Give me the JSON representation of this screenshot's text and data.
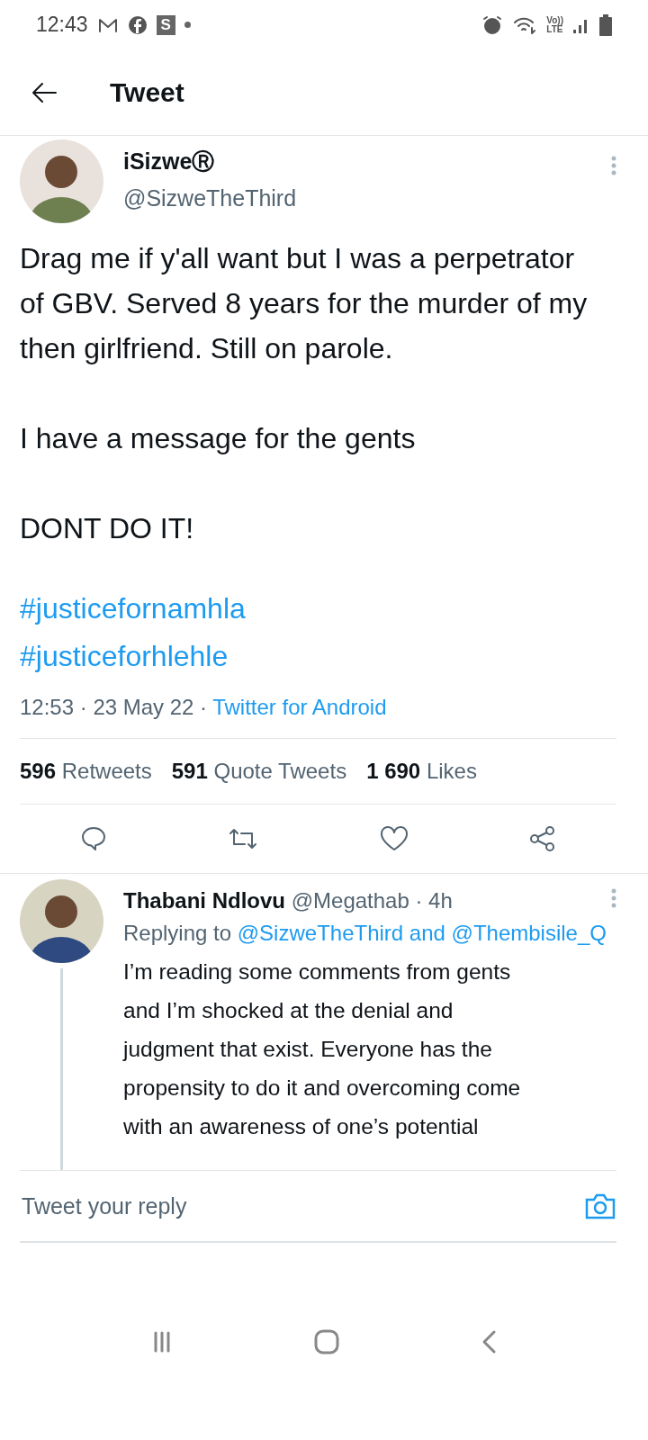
{
  "status_bar": {
    "time": "12:43",
    "app_badge": "S",
    "network_top": "Vo))",
    "network_bottom": "LTE"
  },
  "header": {
    "title": "Tweet"
  },
  "tweet": {
    "name": "iSizweⓇ",
    "handle": "@SizweTheThird",
    "paragraphs": [
      "Drag me if y'all want but I was a perpetrator of GBV. Served 8 years for the murder of my then girlfriend. Still on parole.",
      "I have a message for the gents",
      "DONT DO IT!"
    ],
    "hashtags": [
      "#justicefornamhla",
      "#justiceforhlehle"
    ],
    "time": "12:53 · 23 May 22 ·",
    "source": "Twitter for Android",
    "stats": [
      {
        "count": "596",
        "label": "Retweets"
      },
      {
        "count": "591",
        "label": "Quote Tweets"
      },
      {
        "count": "1 690",
        "label": "Likes"
      }
    ]
  },
  "reply": {
    "name": "Thabani Ndlovu",
    "meta": "@Megathab · 4h",
    "replying_prefix": "Replying to",
    "mentions": [
      "@SizweTheThird and",
      "@Thembisile_Q"
    ],
    "lines": [
      "I’m reading some comments from gents",
      "and I’m shocked at the denial and",
      "judgment that exist. Everyone has the",
      "propensity to do it and overcoming come",
      "with an awareness of one’s potential"
    ]
  },
  "composer": {
    "placeholder": "Tweet your reply"
  }
}
